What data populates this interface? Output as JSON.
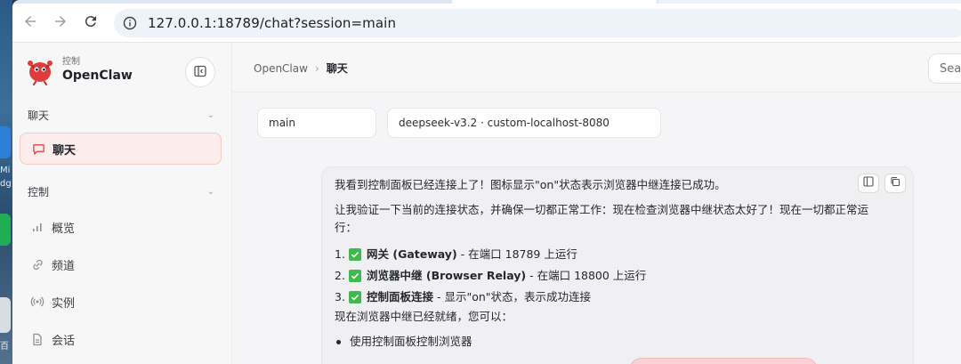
{
  "browser": {
    "url": "127.0.0.1:18789/chat?session=main"
  },
  "desktop": {
    "labels": [
      "Mi",
      "dg",
      "百"
    ]
  },
  "sidebar": {
    "brand_sub": "控制",
    "brand_name": "OpenClaw",
    "groups": [
      {
        "label": "聊天"
      },
      {
        "label": "控制"
      }
    ],
    "items": [
      {
        "label": "聊天",
        "icon": "message-icon",
        "active": true
      },
      {
        "label": "概览",
        "icon": "chart-icon"
      },
      {
        "label": "频道",
        "icon": "link-icon"
      },
      {
        "label": "实例",
        "icon": "broadcast-icon"
      },
      {
        "label": "会话",
        "icon": "document-icon"
      }
    ]
  },
  "header": {
    "breadcrumb_root": "OpenClaw",
    "breadcrumb_sep": "›",
    "breadcrumb_current": "聊天",
    "search_placeholder": "Searc"
  },
  "session": {
    "session_select": "main",
    "model_select": "deepseek-v3.2 · custom-localhost-8080"
  },
  "message": {
    "para1": "我看到控制面板已经连接上了！图标显示\"on\"状态表示浏览器中继连接已成功。",
    "para2": "让我验证一下当前的连接状态，并确保一切都正常工作：现在检查浏览器中继状态太好了！现在一切都正常运行：",
    "items": [
      {
        "num": "1.",
        "bold": "网关 (Gateway)",
        "rest": " - 在端口 18789 上运行"
      },
      {
        "num": "2.",
        "bold": "浏览器中继 (Browser Relay)",
        "rest": " - 在端口 18800 上运行"
      },
      {
        "num": "3.",
        "bold": "控制面板连接",
        "rest": " - 显示\"on\"状态，表示成功连接"
      }
    ],
    "para3": "现在浏览器中继已经就绪，您可以：",
    "bullets": [
      "使用控制面板控制浏览器"
    ]
  },
  "colors": {
    "accent": "#e5484d",
    "check_green": "#3fb950"
  }
}
